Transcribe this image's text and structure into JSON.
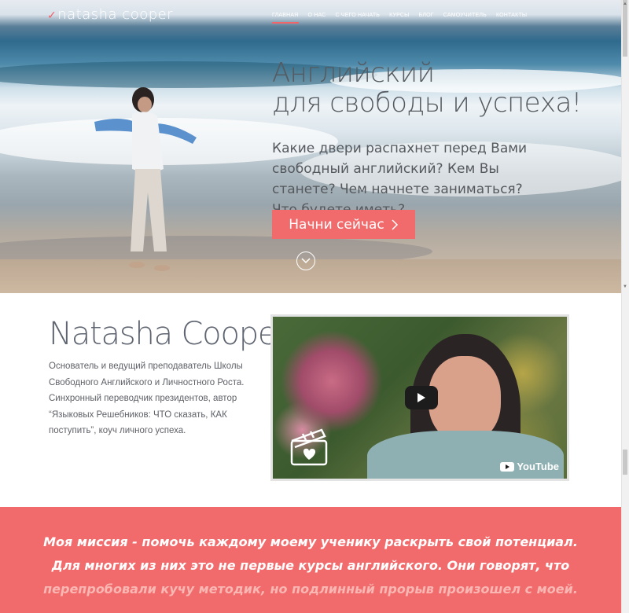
{
  "header": {
    "logo_text": "natasha cooper",
    "nav": [
      {
        "label": "ГЛАВНАЯ",
        "active": true
      },
      {
        "label": "О НАС",
        "active": false
      },
      {
        "label": "С ЧЕГО НАЧАТЬ",
        "active": false
      },
      {
        "label": "КУРСЫ",
        "active": false
      },
      {
        "label": "БЛОГ",
        "active": false
      },
      {
        "label": "САМОУЧИТЕЛЬ",
        "active": false
      },
      {
        "label": "КОНТАКТЫ",
        "active": false
      }
    ]
  },
  "hero": {
    "title_line1": "Английский",
    "title_line2": "для свободы и успеха!",
    "subtitle": "Какие двери распахнет перед Вами свободный английский? Кем Вы станете? Чем начнете заниматься? Что будете иметь?",
    "cta_label": "Начни сейчас",
    "cta_icon": "chevron-right-icon",
    "scroll_icon": "chevron-down-circle-icon"
  },
  "about": {
    "name": "Natasha Cooper",
    "bio": "Основатель и ведущий преподаватель Школы Свободного Английского и Личностного Роста. Синхронный переводчик президентов, автор “Языковых Решебников: ЧТО сказать, КАК поступить”, коуч личного успеха.",
    "video": {
      "provider_label": "YouTube",
      "play_icon": "play-icon",
      "overlay_icon": "clapperboard-heart-icon"
    }
  },
  "mission": {
    "line1": "Моя миссия - помочь каждому моему ученику раскрыть свой потенциал.",
    "line2": "Для многих из них это не первые курсы английского. Они говорят, что",
    "line3": "перепробовали кучу методик, но подлинный прорыв произошел с моей."
  },
  "colors": {
    "accent": "#f26b6c",
    "text_dark": "#55595e",
    "mission_bg": "#f26b6c"
  }
}
